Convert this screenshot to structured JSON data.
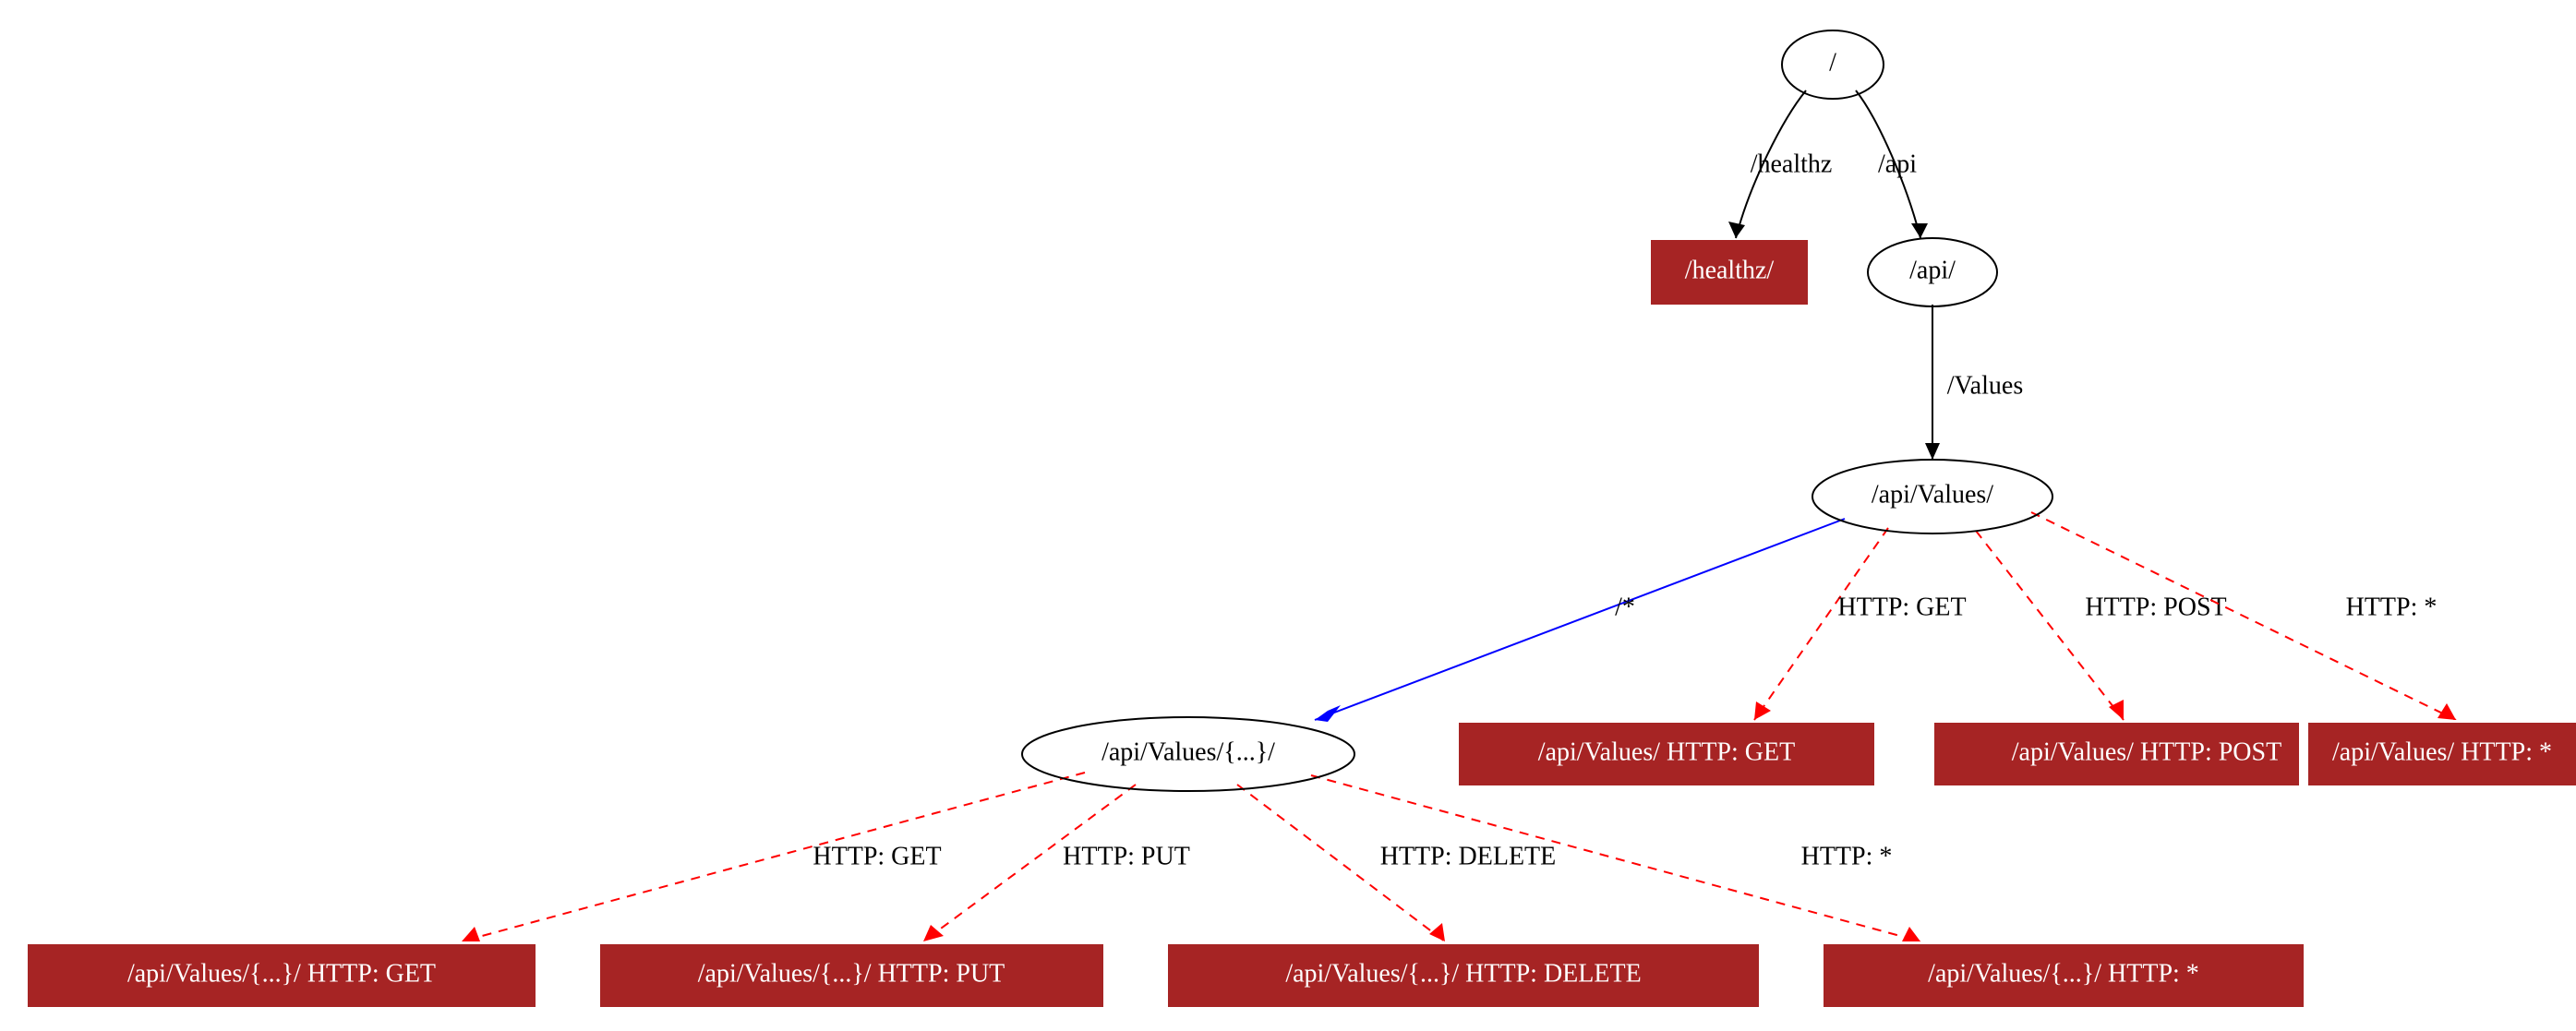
{
  "colors": {
    "box_fill": "#a62424",
    "edge_red": "#ff0000",
    "edge_blue": "#0000ff",
    "edge_black": "#000000"
  },
  "nodes": {
    "root": {
      "type": "ellipse",
      "label": "/"
    },
    "healthz": {
      "type": "box",
      "label": "/healthz/"
    },
    "api": {
      "type": "ellipse",
      "label": "/api/"
    },
    "apiValues": {
      "type": "ellipse",
      "label": "/api/Values/"
    },
    "apiValuesGet": {
      "type": "box",
      "label": "/api/Values/ HTTP: GET"
    },
    "apiValuesPost": {
      "type": "box",
      "label": "/api/Values/ HTTP: POST"
    },
    "apiValuesStar": {
      "type": "box",
      "label": "/api/Values/ HTTP: *"
    },
    "apiValuesId": {
      "type": "ellipse",
      "label": "/api/Values/{...}/"
    },
    "idGet": {
      "type": "box",
      "label": "/api/Values/{...}/ HTTP: GET"
    },
    "idPut": {
      "type": "box",
      "label": "/api/Values/{...}/ HTTP: PUT"
    },
    "idDelete": {
      "type": "box",
      "label": "/api/Values/{...}/ HTTP: DELETE"
    },
    "idStar": {
      "type": "box",
      "label": "/api/Values/{...}/ HTTP: *"
    }
  },
  "edges": {
    "e_root_healthz": {
      "label": "/healthz"
    },
    "e_root_api": {
      "label": "/api"
    },
    "e_api_values": {
      "label": "/Values"
    },
    "e_values_id": {
      "label": "/*"
    },
    "e_values_get": {
      "label": "HTTP: GET"
    },
    "e_values_post": {
      "label": "HTTP: POST"
    },
    "e_values_star": {
      "label": "HTTP: *"
    },
    "e_id_get": {
      "label": "HTTP: GET"
    },
    "e_id_put": {
      "label": "HTTP: PUT"
    },
    "e_id_delete": {
      "label": "HTTP: DELETE"
    },
    "e_id_star": {
      "label": "HTTP: *"
    }
  }
}
